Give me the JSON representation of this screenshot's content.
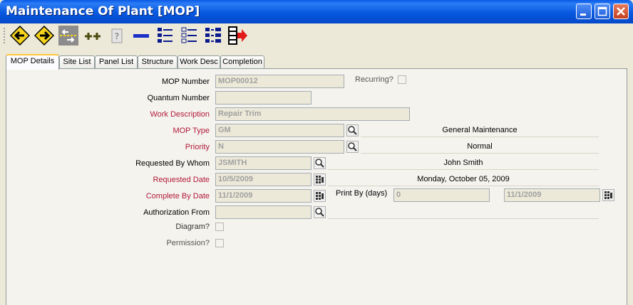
{
  "window": {
    "title": "Maintenance Of Plant [MOP]"
  },
  "window_controls": [
    {
      "name": "minimize-icon"
    },
    {
      "name": "maximize-icon"
    },
    {
      "name": "close-icon"
    }
  ],
  "toolbar": [
    {
      "name": "previous-record-icon"
    },
    {
      "name": "next-record-icon"
    },
    {
      "name": "go-to-record-icon"
    },
    {
      "name": "add-record-icon"
    },
    {
      "name": "help-icon"
    },
    {
      "name": "remove-record-icon"
    },
    {
      "name": "list-view-icon"
    },
    {
      "name": "detail-list-icon"
    },
    {
      "name": "tree-view-icon"
    },
    {
      "name": "exit-icon"
    }
  ],
  "tabs": [
    "MOP Details",
    "Site List",
    "Panel List",
    "Structure",
    "Work Desc",
    "Completion"
  ],
  "form": {
    "mop_number": {
      "label": "MOP Number",
      "value": "MOP00012"
    },
    "recurring": {
      "label": "Recurring?"
    },
    "quantum_number": {
      "label": "Quantum Number",
      "value": ""
    },
    "work_description": {
      "label": "Work Description",
      "value": "Repair Trim"
    },
    "mop_type": {
      "label": "MOP Type",
      "value": "GM",
      "display": "General Maintenance"
    },
    "priority": {
      "label": "Priority",
      "value": "N",
      "display": "Normal"
    },
    "requested_by": {
      "label": "Requested By Whom",
      "value": "JSMITH",
      "display": "John Smith"
    },
    "requested_date": {
      "label": "Requested Date",
      "value": "10/5/2009",
      "display": "Monday, October 05, 2009"
    },
    "complete_by_date": {
      "label": "Complete By Date",
      "value": "11/1/2009"
    },
    "print_by": {
      "label": "Print By (days)",
      "value": "0",
      "date": "11/1/2009"
    },
    "authorization_from": {
      "label": "Authorization From",
      "value": "",
      "display": ""
    },
    "diagram": {
      "label": "Diagram?"
    },
    "permission": {
      "label": "Permission?"
    }
  }
}
